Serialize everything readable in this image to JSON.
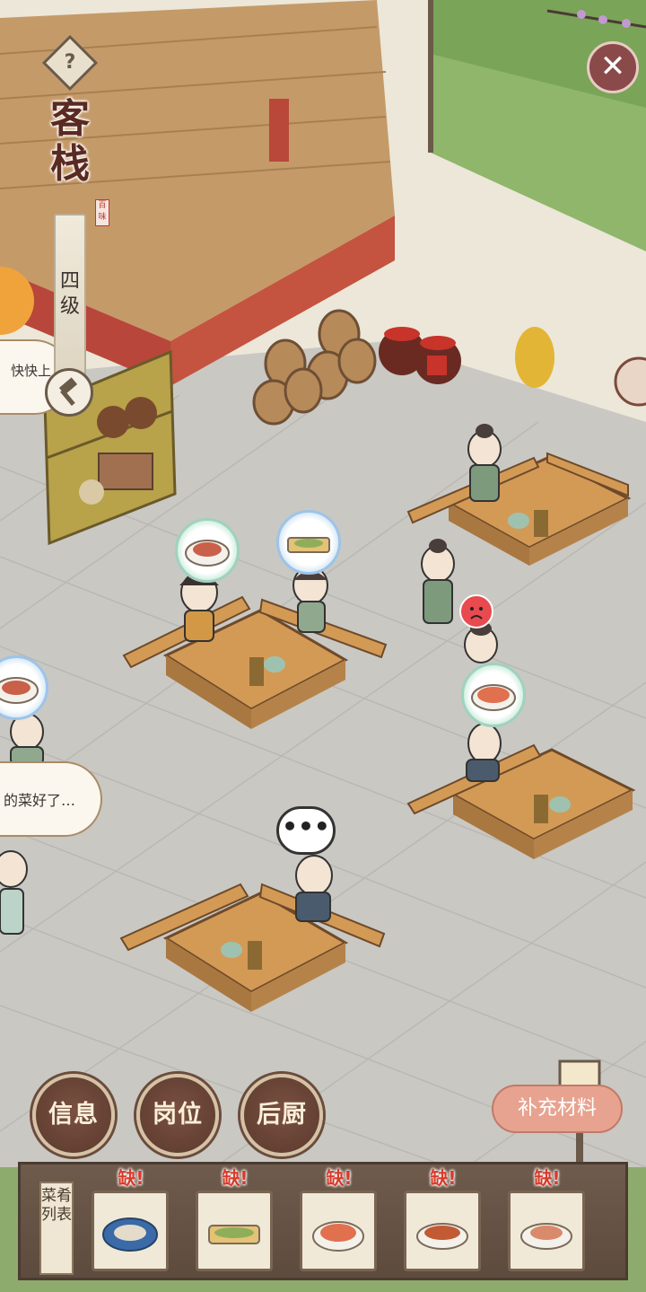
{
  "header": {
    "help_icon": "question-icon",
    "title": "客栈",
    "seal_text": "百味",
    "level": "四级",
    "close_icon": "close-icon"
  },
  "speech": {
    "left_top": "快快上",
    "left_middle": "的菜好了…",
    "thinking": "•••"
  },
  "buttons": {
    "info": "信息",
    "post": "岗位",
    "kitchen": "后厨",
    "supply": "补充材料"
  },
  "dish_list": {
    "label": "菜肴列表",
    "items": [
      {
        "status": "缺!",
        "dish": "blue-plate-dish"
      },
      {
        "status": "缺!",
        "dish": "fish-dish"
      },
      {
        "status": "缺!",
        "dish": "soup-bowl-dish"
      },
      {
        "status": "缺!",
        "dish": "braised-pork-dish"
      },
      {
        "status": "缺!",
        "dish": "meat-plate-dish"
      }
    ]
  },
  "colors": {
    "accent_brown": "#5a3a2e",
    "missing_red": "#d93a2a",
    "supply_pink": "#e7a390",
    "floor_grey": "#c9c8c3"
  }
}
